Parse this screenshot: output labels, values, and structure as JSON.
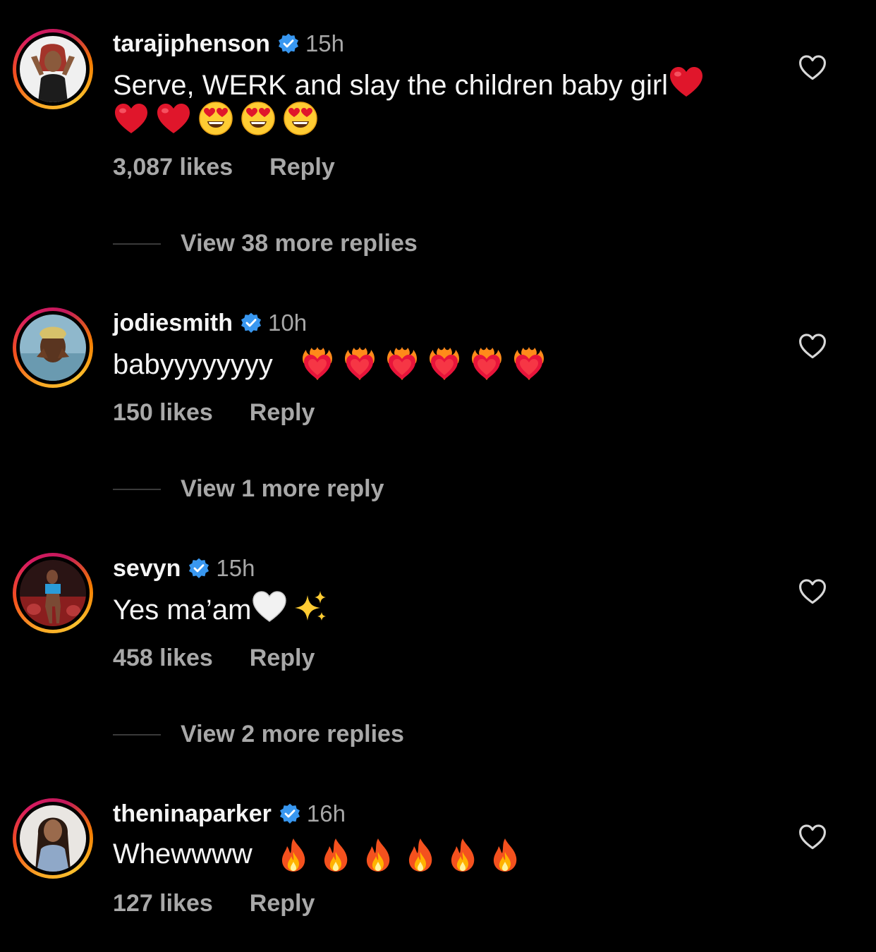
{
  "comments": [
    {
      "username": "tarajiphenson",
      "time": "15h",
      "text": "Serve, WERK and slay the children baby girl",
      "likes": "3,087 likes",
      "reply": "Reply",
      "view_replies": "View 38 more replies"
    },
    {
      "username": "jodiesmith",
      "time": "10h",
      "text": "babyyyyyyyy",
      "likes": "150 likes",
      "reply": "Reply",
      "view_replies": "View 1 more reply"
    },
    {
      "username": "sevyn",
      "time": "15h",
      "text": "Yes ma’am",
      "likes": "458 likes",
      "reply": "Reply",
      "view_replies": "View 2 more replies"
    },
    {
      "username": "theninaparker",
      "time": "16h",
      "text": "Whewwww",
      "likes": "127 likes",
      "reply": "Reply"
    }
  ],
  "icons": {
    "verified": "verified-badge-icon",
    "like": "heart-outline-icon",
    "red_heart": "red-heart-emoji",
    "heart_eyes": "heart-eyes-emoji",
    "heart_on_fire": "heart-on-fire-emoji",
    "white_heart": "white-heart-emoji",
    "sparkles": "sparkles-emoji",
    "fire": "fire-emoji"
  },
  "colors": {
    "background": "#000000",
    "primary_text": "#f5f5f5",
    "secondary_text": "#a8a8a8",
    "verified_blue": "#3897f0"
  }
}
